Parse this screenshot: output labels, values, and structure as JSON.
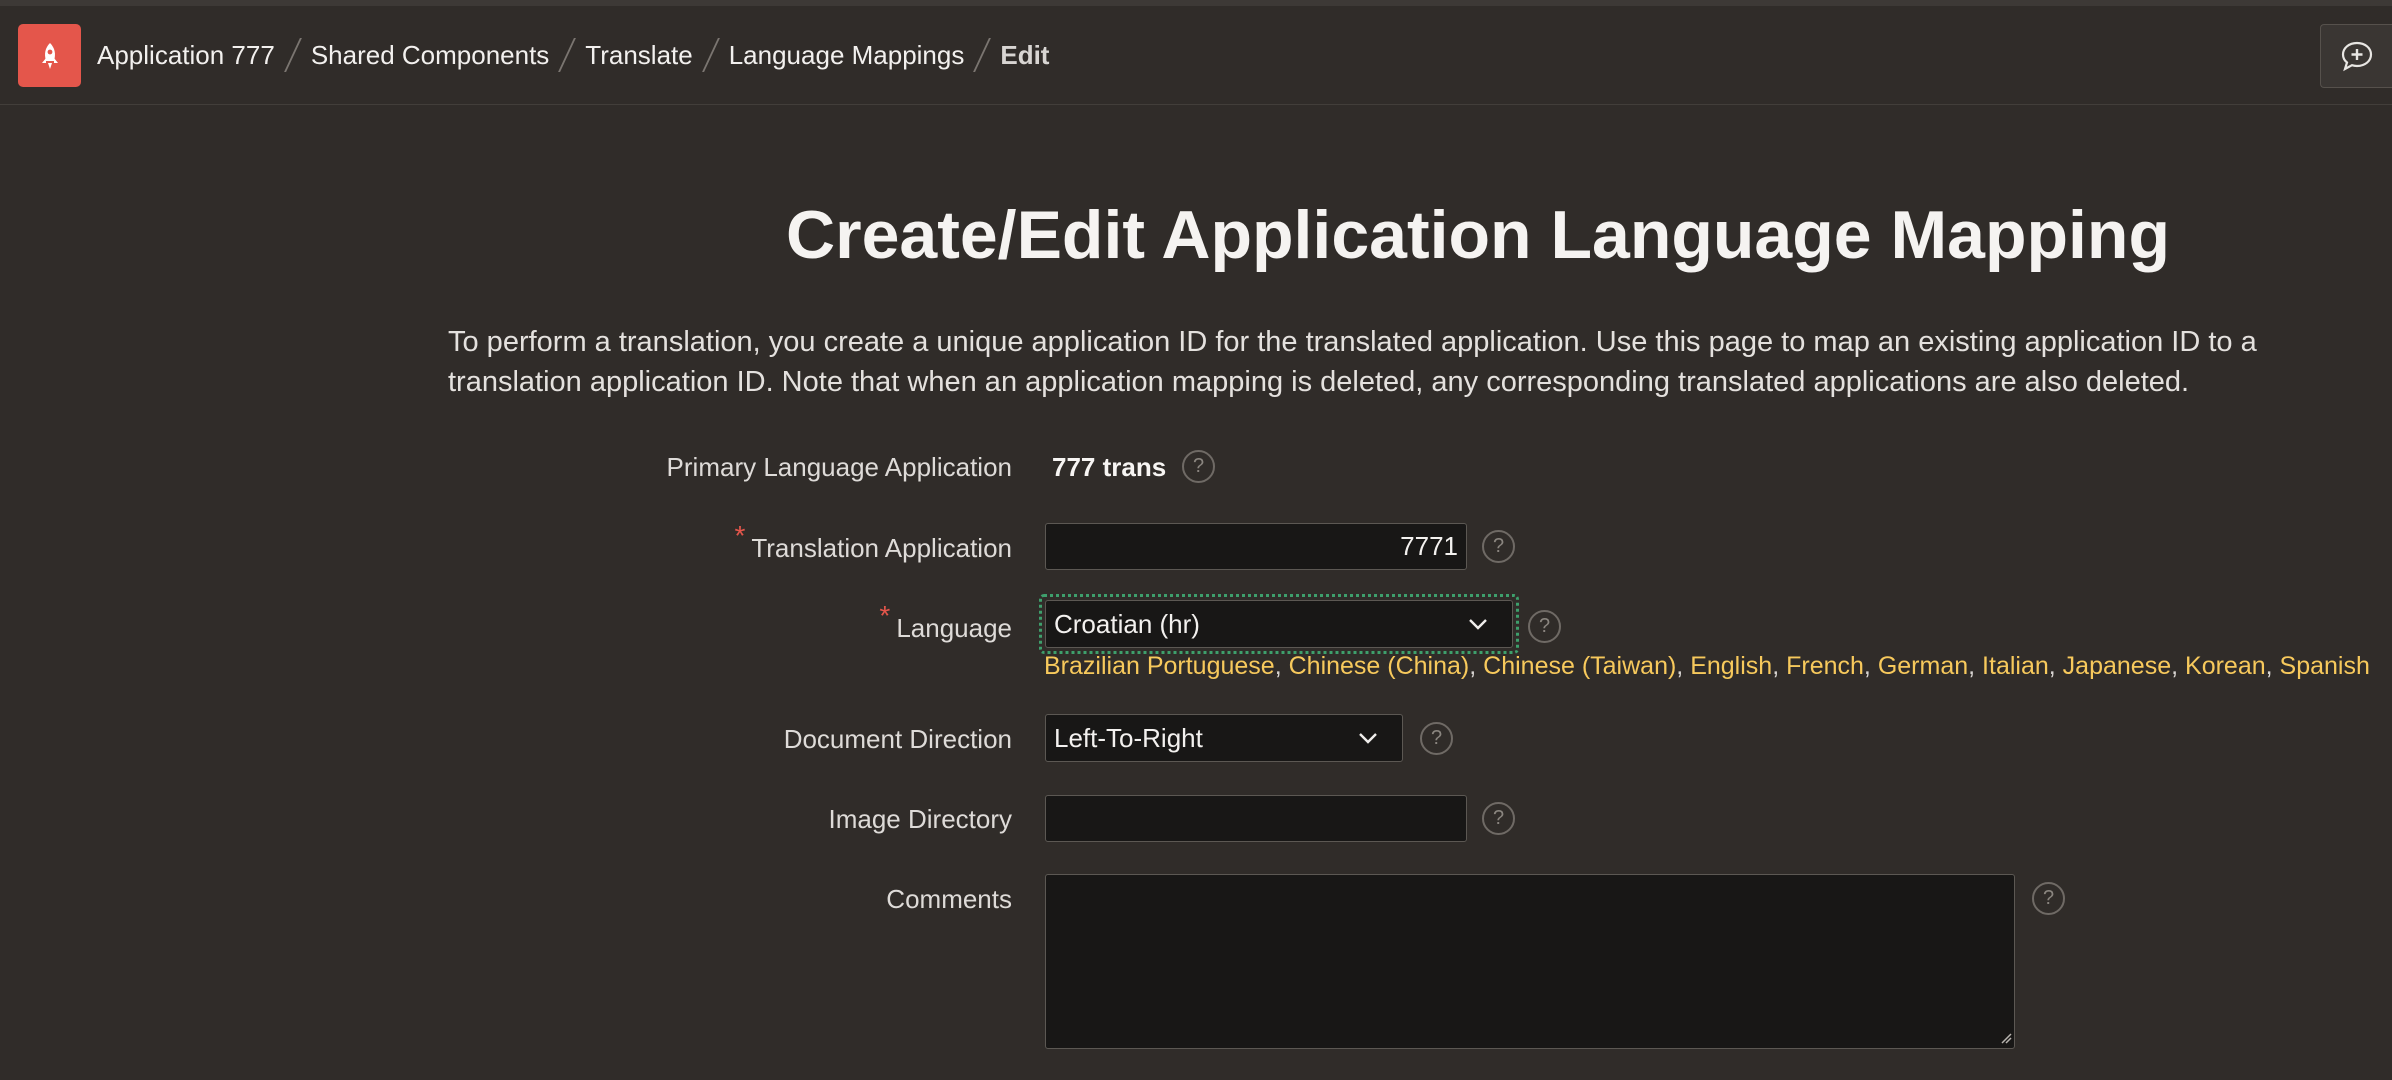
{
  "breadcrumb": {
    "items": [
      "Application 777",
      "Shared Components",
      "Translate",
      "Language Mappings"
    ],
    "current": "Edit"
  },
  "page": {
    "title": "Create/Edit Application Language Mapping",
    "intro": "To perform a translation, you create a unique application ID for the translated application. Use this page to map an existing application ID to a translation application ID. Note that when an application mapping is deleted, any corresponding translated applications are also deleted."
  },
  "form": {
    "primary_label": "Primary Language Application",
    "primary_value": "777 trans",
    "translation_label": "Translation Application",
    "translation_value": "7771",
    "language_label": "Language",
    "language_value": "Croatian (hr)",
    "language_links": [
      "Brazilian Portuguese",
      "Chinese (China)",
      "Chinese (Taiwan)",
      "English",
      "French",
      "German",
      "Italian",
      "Japanese",
      "Korean",
      "Spanish"
    ],
    "direction_label": "Document Direction",
    "direction_value": "Left-To-Right",
    "image_dir_label": "Image Directory",
    "image_dir_value": "",
    "comments_label": "Comments",
    "comments_value": "",
    "required_marker": "*",
    "help_glyph": "?"
  },
  "colors": {
    "background": "#302c29",
    "accent_logo": "#e4564b",
    "link": "#f7c95c",
    "focus": "#3e9f6c"
  },
  "icons": {
    "logo": "rocket-icon",
    "feedback": "feedback-chat-icon",
    "select": "chevron-down-icon"
  }
}
